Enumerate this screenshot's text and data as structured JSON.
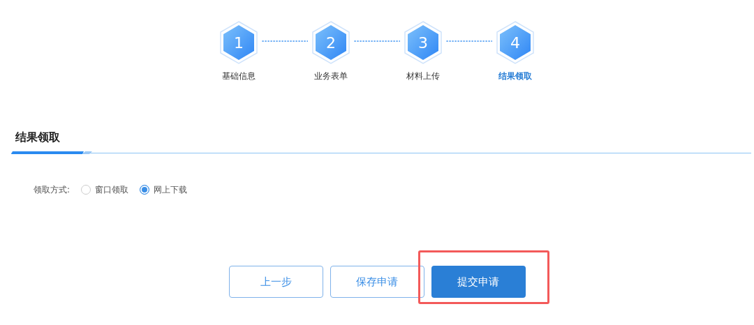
{
  "steps": [
    {
      "number": "1",
      "label": "基础信息",
      "selected": false
    },
    {
      "number": "2",
      "label": "业务表单",
      "selected": false
    },
    {
      "number": "3",
      "label": "材料上传",
      "selected": false
    },
    {
      "number": "4",
      "label": "结果领取",
      "selected": true
    }
  ],
  "section": {
    "title": "结果领取"
  },
  "field": {
    "label": "领取方式:",
    "options": [
      {
        "label": "窗口领取",
        "selected": false
      },
      {
        "label": "网上下载",
        "selected": true
      }
    ]
  },
  "buttons": [
    {
      "label": "上一步",
      "kind": "outline",
      "highlighted": false
    },
    {
      "label": "保存申请",
      "kind": "outline",
      "highlighted": false
    },
    {
      "label": "提交申请",
      "kind": "primary",
      "highlighted": true
    }
  ]
}
